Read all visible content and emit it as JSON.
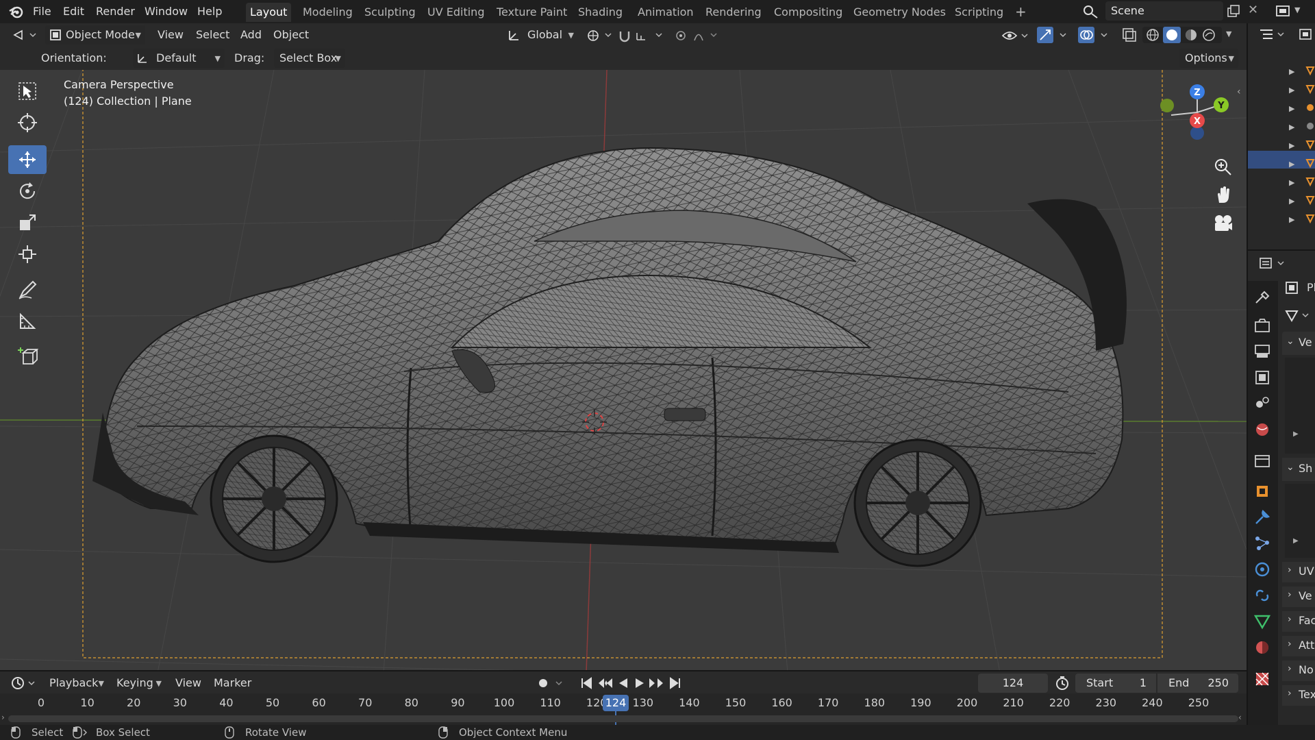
{
  "menu": [
    "File",
    "Edit",
    "Render",
    "Window",
    "Help"
  ],
  "workspaces": [
    "Layout",
    "Modeling",
    "Sculpting",
    "UV Editing",
    "Texture Paint",
    "Shading",
    "Animation",
    "Rendering",
    "Compositing",
    "Geometry Nodes",
    "Scripting"
  ],
  "active_workspace": "Layout",
  "scene_name": "Scene",
  "header": {
    "mode": "Object Mode",
    "view_menu": [
      "View",
      "Select",
      "Add",
      "Object"
    ],
    "transform_orientation": "Global"
  },
  "tool_settings": {
    "orientation_label": "Orientation:",
    "orientation_value": "Default",
    "drag_label": "Drag:",
    "drag_value": "Select Box",
    "options_label": "Options"
  },
  "viewport": {
    "overlay_line1": "Camera Perspective",
    "overlay_line2": "(124) Collection | Plane"
  },
  "gizmo_axes": {
    "z": "Z",
    "y": "Y",
    "x": "X"
  },
  "colors": {
    "accent": "#4772b3",
    "x_axis": "#e64a4a",
    "y_axis": "#8ac926",
    "z_axis": "#3b7fe6",
    "selection": "#e0a030",
    "playhead": "#4772b3"
  },
  "properties_panels": [
    "Ve",
    "Sh",
    "UV",
    "Ve",
    "Fac",
    "Att",
    "No",
    "Tex"
  ],
  "properties_header": "Pl",
  "timeline": {
    "menus": [
      "Playback",
      "Keying",
      "View",
      "Marker"
    ],
    "current_frame": "124",
    "start_label": "Start",
    "start_value": "1",
    "end_label": "End",
    "end_value": "250",
    "ruler": [
      "0",
      "10",
      "20",
      "30",
      "40",
      "50",
      "60",
      "70",
      "80",
      "90",
      "100",
      "110",
      "120",
      "130",
      "140",
      "150",
      "160",
      "170",
      "180",
      "190",
      "200",
      "210",
      "220",
      "230",
      "240",
      "250"
    ]
  },
  "status_bar": {
    "select": "Select",
    "box_select": "Box Select",
    "rotate_view": "Rotate View",
    "context_menu": "Object Context Menu"
  }
}
